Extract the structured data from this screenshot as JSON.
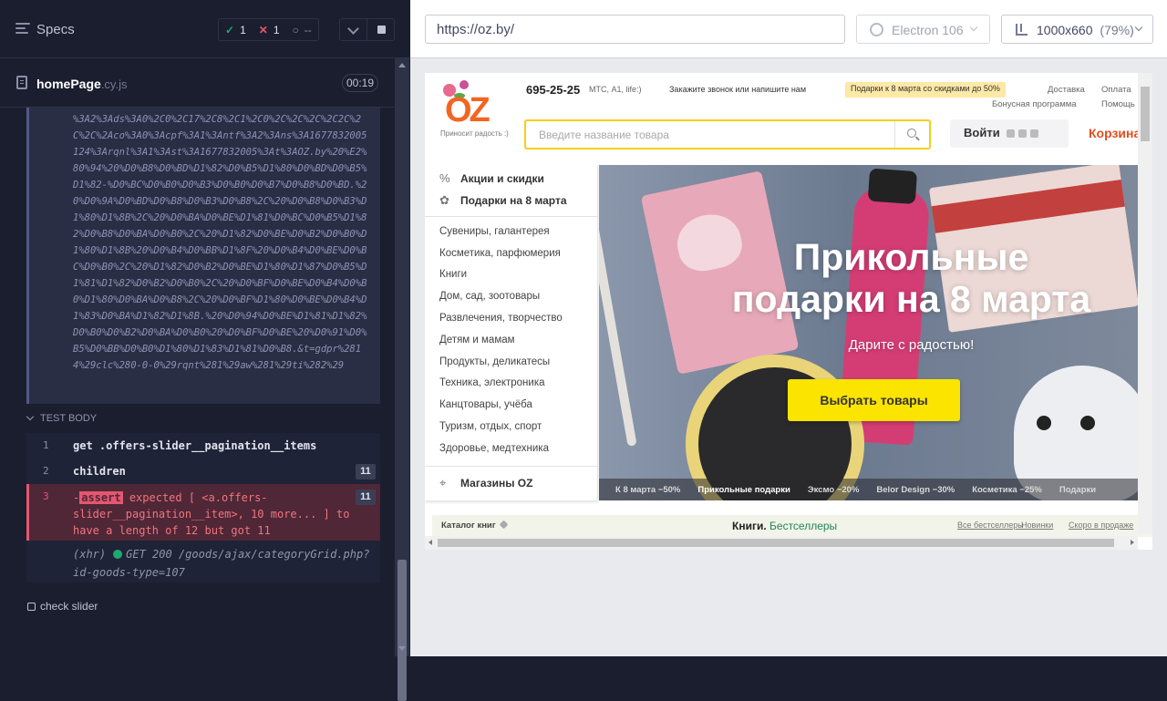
{
  "reporter": {
    "title": "Specs",
    "stats": {
      "passed": "1",
      "failed": "1",
      "pending": "--"
    },
    "spec": {
      "name": "homePage",
      "ext": ".cy.js",
      "duration": "00:19"
    },
    "visit_url": "%3A2%3Ads%3A0%2C0%2C17%2C8%2C1%2C0%2C%2C%2C%2C2C%2C%2C%2Aco%3A0%3Acpf%3A1%3Antf%3A2%3Ans%3A1677832005124%3Arqnl%3A1%3Ast%3A1677832005%3At%3AOZ.by%20%E2%80%94%20%D0%B8%D0%BD%D1%82%D0%B5%D1%80%D0%BD%D0%B5%D1%82-%D0%BC%D0%B0%D0%B3%D0%B0%D0%B7%D0%B8%D0%BD.%20%D0%9A%D0%BD%D0%B8%D0%B3%D0%B8%2C%20%D0%B8%D0%B3%D1%80%D1%8B%2C%20%D0%BA%D0%BE%D1%81%D0%BC%D0%B5%D1%82%D0%B8%D0%BA%D0%B0%2C%20%D1%82%D0%BE%D0%B2%D0%B0%D1%80%D1%8B%20%D0%B4%D0%BB%D1%8F%20%D0%B4%D0%BE%D0%BC%D0%B0%2C%20%D1%82%D0%B2%D0%BE%D1%80%D1%87%D0%B5%D1%81%D1%82%D0%B2%D0%B0%2C%20%D0%BF%D0%BE%D0%B4%D0%B0%D1%80%D0%BA%D0%B8%2C%20%D0%BF%D1%80%D0%BE%D0%B4%D1%83%D0%BA%D1%82%D1%8B.%20%D0%94%D0%BE%D1%81%D1%82%D0%B0%D0%B2%D0%BA%D0%B0%20%D0%BF%D0%BE%20%D0%91%D0%B5%D0%BB%D0%B0%D1%80%D1%83%D1%81%D0%B8.&t=gdpr%2814%29clc%280-0-0%29rqnt%281%29aw%281%29ti%282%29",
    "test_body_label": "TEST BODY",
    "commands": [
      {
        "num": "1",
        "text": "get  .offers-slider__pagination__items",
        "badge": ""
      },
      {
        "num": "2",
        "text": "children",
        "badge": "11"
      },
      {
        "num": "3",
        "prefix": "-",
        "tag": "assert",
        "text": " expected [ <a.offers-slider__pagination__item>, 10 more... ] to have a length of 12 but got 11",
        "badge": "11"
      }
    ],
    "xhr": {
      "prefix": "(xhr)",
      "text": "GET 200 /goods/ajax/categoryGrid.php?id-goods-type=107"
    },
    "next_test": "check slider"
  },
  "aut": {
    "url": "https://oz.by/",
    "browser": "Electron 106",
    "viewport": "1000x660",
    "zoom": "(79%)"
  },
  "site": {
    "logo_tagline": "Приносит радость :)",
    "phone": "695-25-25",
    "operators": "МТС, А1, life:)",
    "callback": "Закажите звонок или напишите нам",
    "promo": "Подарки к 8 марта со скидками до 50%",
    "links": {
      "delivery": "Доставка",
      "payment": "Оплата",
      "bonus": "Бонусная программа",
      "help": "Помощь"
    },
    "search_placeholder": "Введите название товара",
    "login": "Войти",
    "cart": "Корзина",
    "menu_top": [
      "Акции и скидки",
      "Подарки на 8 марта"
    ],
    "menu_items": [
      "Сувениры, галантерея",
      "Косметика, парфюмерия",
      "Книги",
      "Дом, сад, зоотовары",
      "Развлечения, творчество",
      "Детям и мамам",
      "Продукты, деликатесы",
      "Техника, электроника",
      "Канцтовары, учёба",
      "Туризм, отдых, спорт",
      "Здоровье, медтехника"
    ],
    "menu_stores": "Магазины OZ",
    "hero": {
      "title_line1": "Прикольные",
      "title_line2": "подарки на 8 марта",
      "subtitle": "Дарите с радостью!",
      "button": "Выбрать товары"
    },
    "slider_tabs": [
      "К 8 марта −50%",
      "Прикольные подарки",
      "Эксмо −20%",
      "Belor Design −30%",
      "Косметика −25%",
      "Подарки"
    ],
    "books": {
      "catalog": "Каталог книг",
      "title_prefix": "Книги.",
      "title_suffix": "Бестселлеры",
      "links": [
        "Все бестселлеры",
        "Новинки",
        "Скоро в продаже"
      ]
    }
  },
  "colors": {
    "pass": "#1fa971",
    "fail": "#e45770",
    "accent": "#fbe400",
    "brand": "#f26522"
  }
}
